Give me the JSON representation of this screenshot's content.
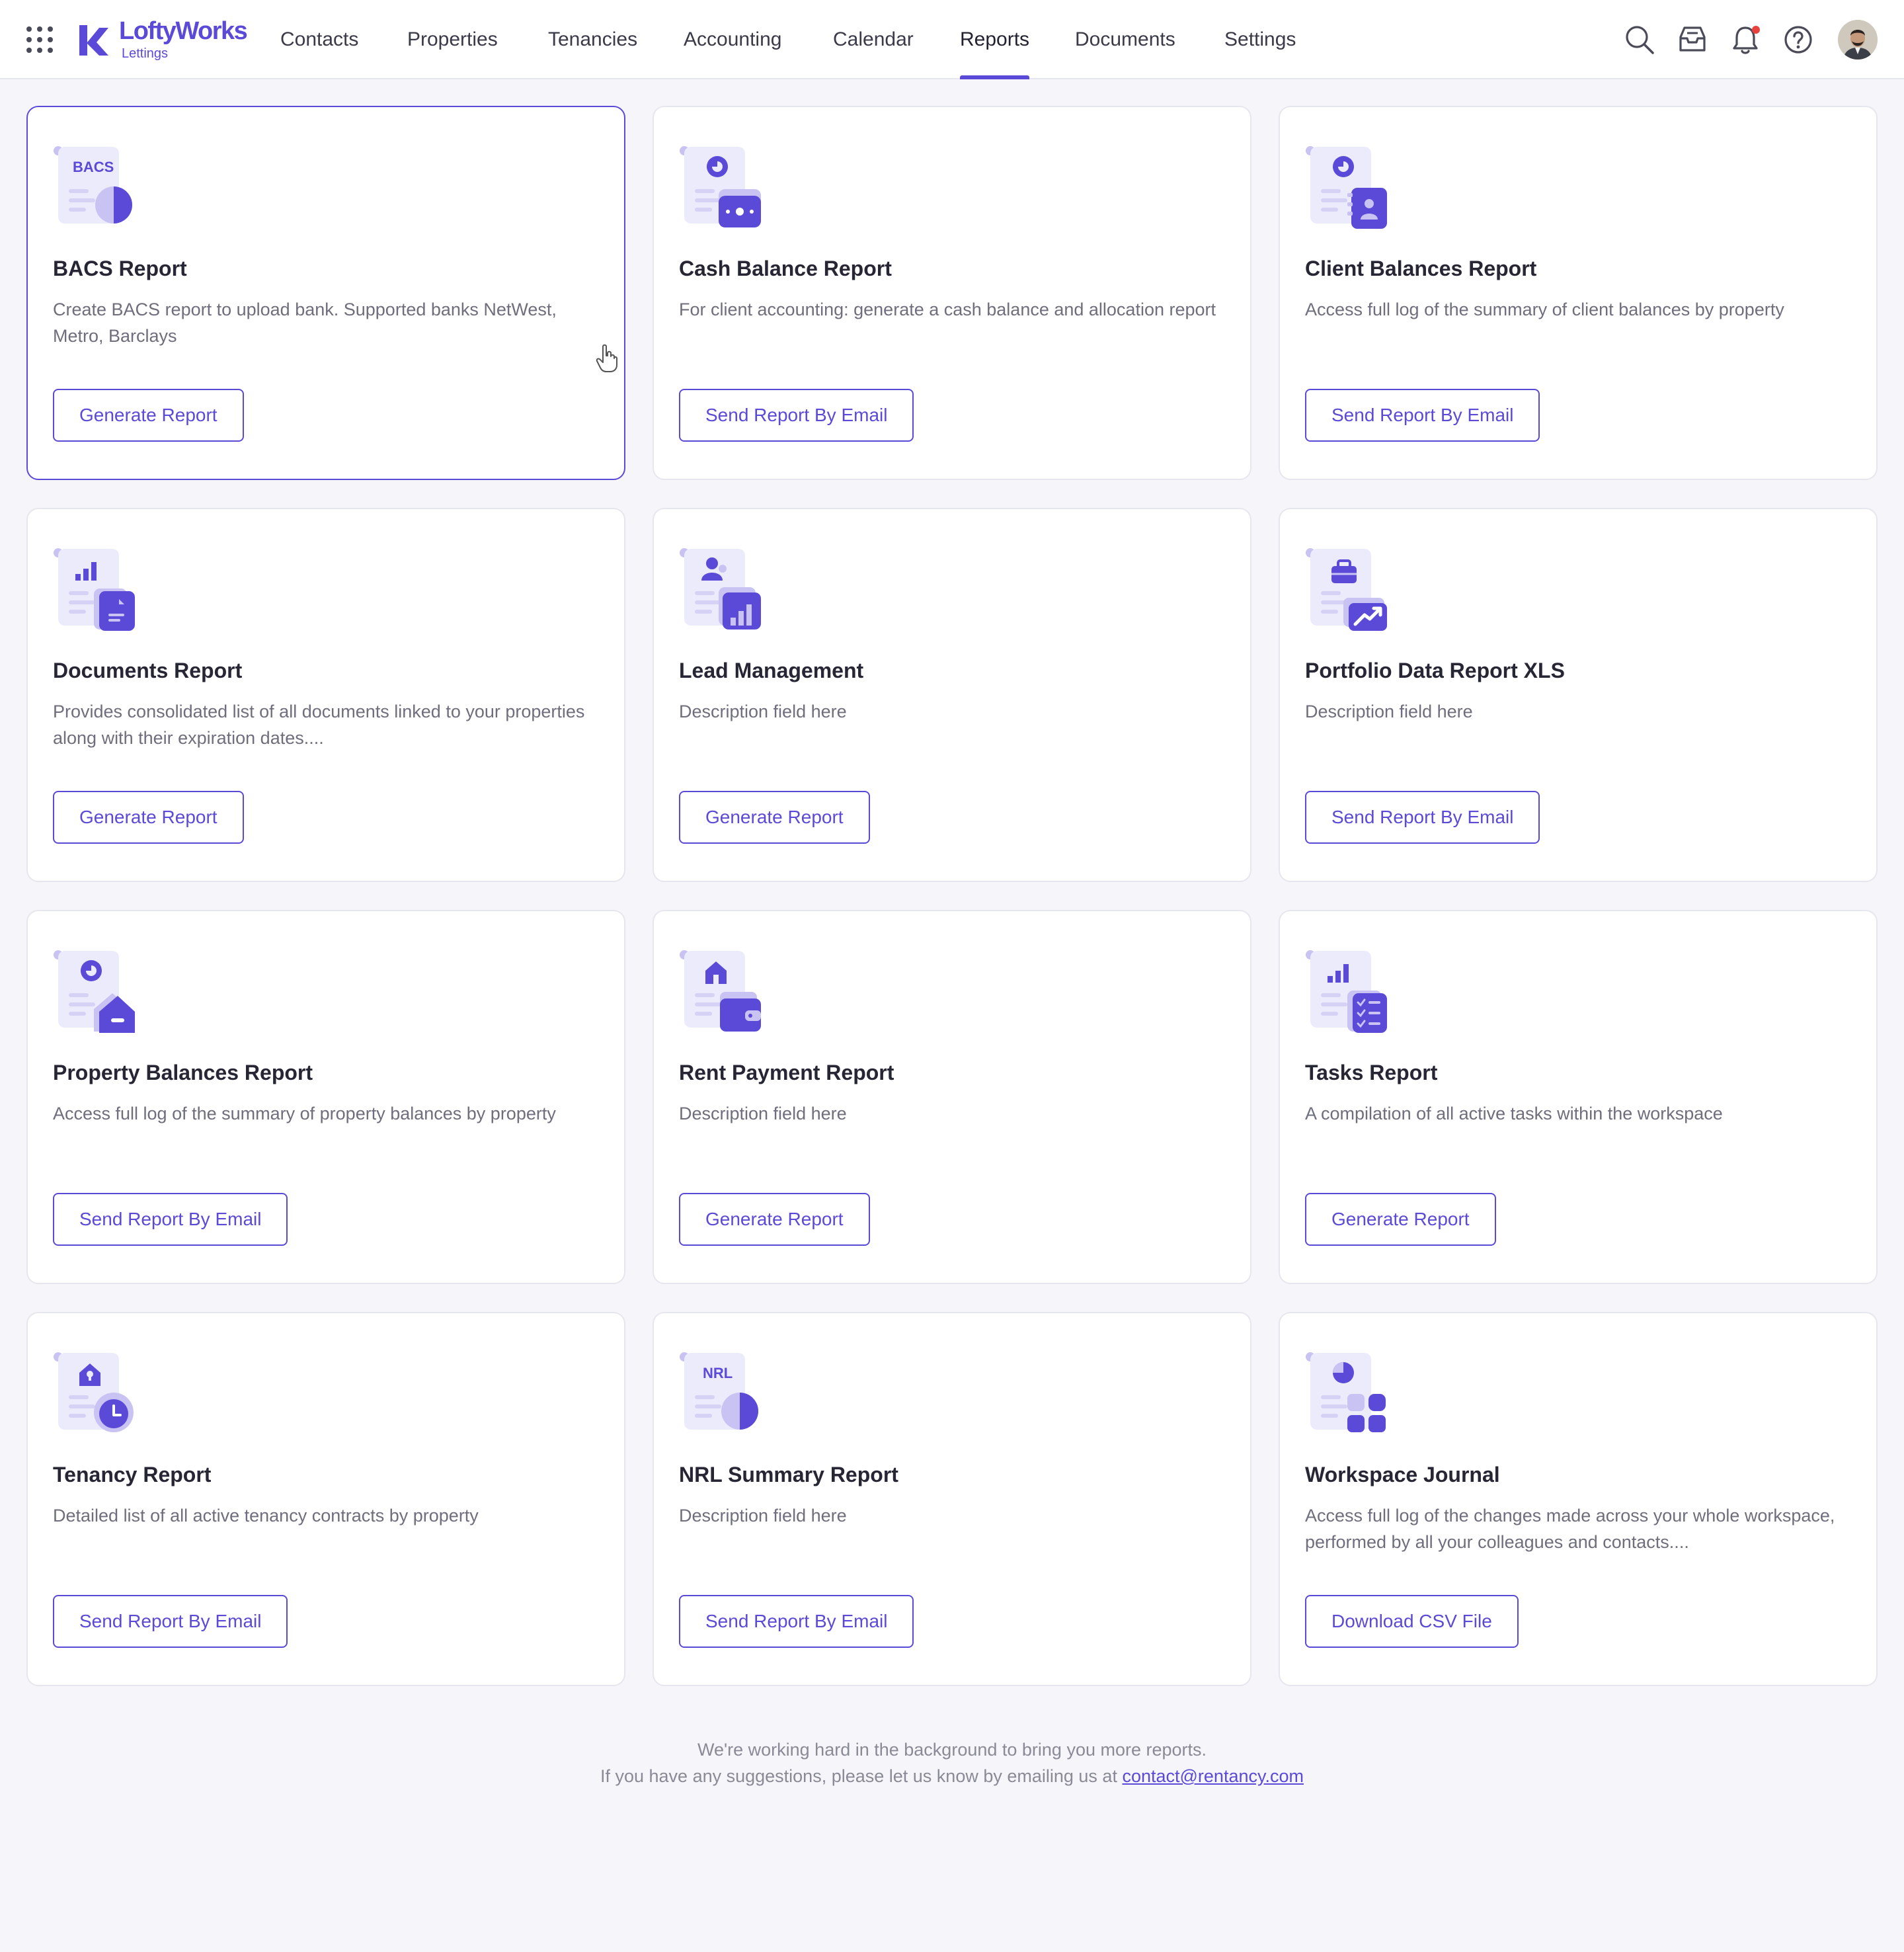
{
  "app": {
    "brand": "LoftyWorks",
    "brand_sub": "Lettings"
  },
  "nav": {
    "items": [
      {
        "label": "Contacts"
      },
      {
        "label": "Properties"
      },
      {
        "label": "Tenancies"
      },
      {
        "label": "Accounting"
      },
      {
        "label": "Calendar"
      },
      {
        "label": "Reports",
        "active": true
      },
      {
        "label": "Documents"
      },
      {
        "label": "Settings"
      }
    ]
  },
  "header_icons": [
    "apps-grid-icon",
    "search-icon",
    "inbox-icon",
    "bell-icon",
    "help-icon",
    "avatar"
  ],
  "colors": {
    "accent": "#5b4ad8",
    "accent_light": "#ecebfb",
    "accent_mid": "#c9c3f3",
    "background": "#f5f5fa",
    "notification": "#e8423f"
  },
  "reports": [
    {
      "title": "BACS Report",
      "description": "Create BACS report to upload bank. Supported banks NetWest, Metro, Barclays",
      "action": "Generate Report",
      "icon": "bacs-pie-icon",
      "icon_text": "BACS"
    },
    {
      "title": "Cash Balance Report",
      "description": "For client accounting: generate a cash balance and allocation report",
      "action": "Send Report By Email",
      "icon": "cash-icon"
    },
    {
      "title": "Client Balances Report",
      "description": "Access full log of the summary of client balances by property",
      "action": "Send Report By Email",
      "icon": "client-contact-icon"
    },
    {
      "title": "Documents Report",
      "description": "Provides consolidated list of all documents linked to your properties along with their expiration dates....",
      "action": "Generate Report",
      "icon": "documents-icon"
    },
    {
      "title": "Lead Management",
      "description": "Description field here",
      "action": "Generate Report",
      "icon": "lead-chart-icon"
    },
    {
      "title": "Portfolio Data Report XLS",
      "description": "Description field here",
      "action": "Send Report By Email",
      "icon": "portfolio-trend-icon"
    },
    {
      "title": "Property Balances Report",
      "description": "Access full log of the summary of property balances by property",
      "action": "Send Report By Email",
      "icon": "property-house-icon"
    },
    {
      "title": "Rent Payment Report",
      "description": "Description field here",
      "action": "Generate Report",
      "icon": "rent-wallet-icon"
    },
    {
      "title": "Tasks Report",
      "description": "A compilation of all active tasks within the workspace",
      "action": "Generate Report",
      "icon": "tasks-checklist-icon"
    },
    {
      "title": "Tenancy Report",
      "description": "Detailed list of all active tenancy contracts by property",
      "action": "Send Report By Email",
      "icon": "tenancy-clock-icon"
    },
    {
      "title": "NRL Summary Report",
      "description": "Description field here",
      "action": "Send Report By Email",
      "icon": "nrl-pie-icon",
      "icon_text": "NRL"
    },
    {
      "title": "Workspace Journal",
      "description": "Access full log of the changes made across your whole workspace, performed by all your colleagues and contacts....",
      "action": "Download CSV File",
      "icon": "workspace-blocks-icon"
    }
  ],
  "footer": {
    "line1": "We're working hard in the background to bring you more reports.",
    "line2": "If you have any suggestions, please let us know by emailing us at",
    "email": "contact@rentancy.com"
  }
}
